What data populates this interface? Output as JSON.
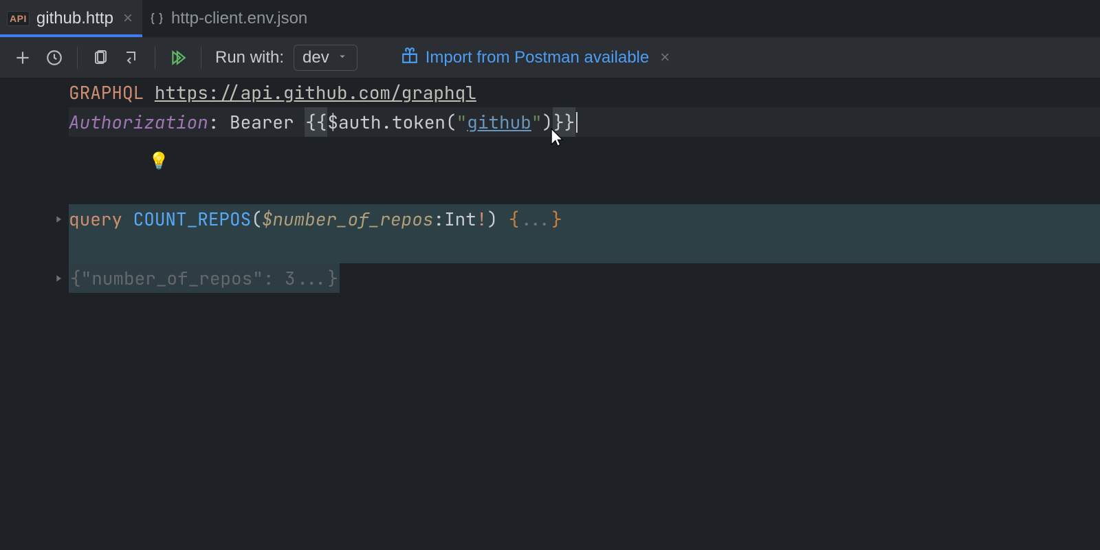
{
  "tabs": [
    {
      "badge": "API",
      "label": "github.http",
      "active": true
    },
    {
      "label": "http-client.env.json",
      "active": false
    }
  ],
  "toolbar": {
    "run_with_label": "Run with:",
    "env_selected": "dev",
    "banner_text": "Import from Postman available"
  },
  "editor": {
    "line1_method": "GRAPHQL",
    "line1_url": "https://api.github.com/graphql",
    "line2_header": "Authorization",
    "line2_sep": ": ",
    "line2_bearer": "Bearer ",
    "line2_tpl_open": "{{",
    "line2_expr_pre": "$auth.token(",
    "line2_str_q": "\"",
    "line2_str_link": "github",
    "line2_expr_post": ")",
    "line2_tpl_close": "}}",
    "bulb": "💡",
    "q_kw": "query",
    "q_name": "COUNT_REPOS",
    "q_paren_open": "(",
    "q_var": "$number_of_repos",
    "q_colon": ":",
    "q_type": "Int",
    "q_bang": "!",
    "q_paren_close": ")",
    "q_brace_open": "{",
    "q_fold": "...",
    "q_brace_close": "}",
    "json_open": "{",
    "json_key_q1": "\"",
    "json_key": "number_of_repos",
    "json_key_q2": "\"",
    "json_colon": ": ",
    "json_val": "3",
    "json_fold": "...",
    "json_close": "}"
  }
}
